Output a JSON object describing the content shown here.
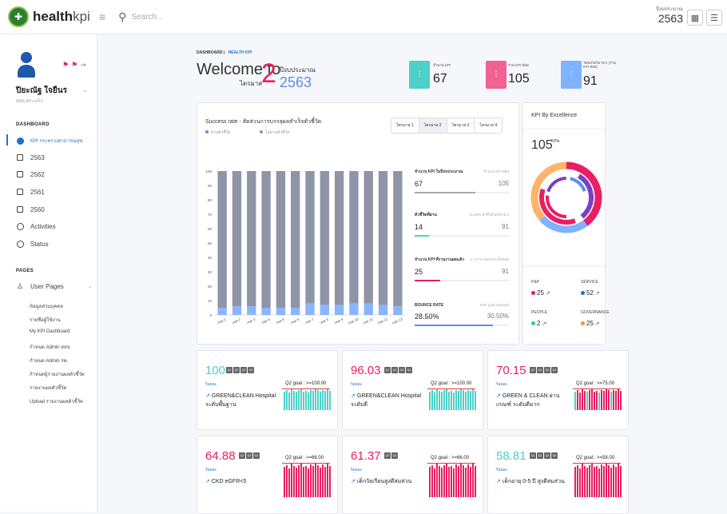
{
  "app": {
    "logo_main": "health",
    "logo_sub": "kpi"
  },
  "search": {
    "placeholder": "Search..."
  },
  "topbar": {
    "year_label": "ปีงบประมาณ",
    "year": "2563"
  },
  "user": {
    "name": "ปิยะณัฐ ใจยืนร",
    "org": "สสจ.สระแก้ว"
  },
  "nav": {
    "dashboard_label": "DASHBOARD",
    "kpi_item": "KPI กระทรวงสาธารณสุข",
    "years": [
      "2563",
      "2562",
      "2561",
      "2560"
    ],
    "activities": "Activities",
    "status": "Status",
    "pages_label": "PAGES",
    "user_pages": "User Pages",
    "sub_pages": [
      "ข้อมูลส่วนบุคคล",
      "รายชื่อผู้ใช้งาน",
      "My KPI Dashboard",
      "กำหนด Admin สสจ.",
      "กำหนด Admin รพ.",
      "กำหนดผู้รายงานผลตัวชี้วัด",
      "รายงานผลตัวชี้วัด",
      "Upload รายงานผลตัวชี้วัด"
    ]
  },
  "header": {
    "crumb1": "DASHBOARD",
    "crumb2": "HEALTH KPI",
    "welcome": "Welcome to",
    "quarter_label": "ไตรมาส",
    "quarter": "2",
    "budget_label": "ปีงบประมาณ",
    "budget_year": "2563"
  },
  "stats": [
    {
      "label": "จำนวน KPI",
      "value": "67",
      "color": "#4dd0c8"
    },
    {
      "label": "รวม KPI ย่อย",
      "value": "105",
      "color": "#f06292"
    },
    {
      "label": "วัดผลไตรมาส 2 (รวม KPI ย่อย)",
      "value": "91",
      "color": "#7fb2ff"
    }
  ],
  "success": {
    "title": "Success rate - สัดส่วนการบรรลุผลสำเร็จตัวชี้วัด",
    "legend": [
      {
        "label": "ผ่านตัวชี้วัด",
        "color": "#5b8def"
      },
      {
        "label": "ไม่ผ่านตัวชี้วัด",
        "color": "#8e95a6"
      }
    ],
    "tabs": [
      "ไตรมาส 1",
      "ไตรมาส 2",
      "ไตรมาส 3",
      "ไตรมาส 4"
    ],
    "active_tab": 1
  },
  "chart_data": {
    "type": "bar",
    "categories": [
      "เขต 1",
      "เขต 2",
      "เขต 3",
      "เขต 4",
      "เขต 5",
      "เขต 6",
      "เขต 7",
      "เขต 8",
      "เขต 9",
      "เขต 10",
      "เขต 11",
      "เขต 12",
      "เขต 13"
    ],
    "series": [
      {
        "name": "ผ่านตัวชี้วัด",
        "values": [
          5,
          6,
          6,
          5,
          5,
          5,
          8,
          7,
          7,
          8,
          8,
          7,
          6
        ],
        "color": "#8ab4ff"
      },
      {
        "name": "ไม่ผ่านตัวชี้วัด",
        "values": [
          95,
          94,
          94,
          95,
          95,
          95,
          92,
          93,
          93,
          92,
          92,
          93,
          94
        ],
        "color": "#8e95a6"
      }
    ],
    "ylim": [
      0,
      100
    ],
    "yticks": [
      0,
      10,
      20,
      30,
      40,
      50,
      60,
      70,
      80,
      90,
      100
    ],
    "stacked": true,
    "grid": false
  },
  "side_stats": [
    {
      "label": "จำนวน KPI ในปีงบประมาณ",
      "right": "จำนวน KPI ย่อย",
      "v1": "67",
      "v2": "105",
      "pct": 64,
      "color": "#aaa"
    },
    {
      "label": "ตัวชี้วัดที่ผ่าน",
      "right": "15.38% ตัวชี้วัดไตรมาส 2",
      "v1": "14",
      "v2": "91",
      "pct": 15,
      "color": "#4dd0c8"
    },
    {
      "label": "จำนวน KPI ที่รายงานผลแล้ว",
      "right": "27.47% ของ KPI ทั้งหมด",
      "v1": "25",
      "v2": "91",
      "pct": 27,
      "color": "#e91e63"
    },
    {
      "label": "BOUNCE RATE",
      "right": "83% goal reached",
      "v1": "28.50%",
      "v2": "30.50%",
      "pct": 83,
      "color": "#5b8def"
    }
  ],
  "excellence": {
    "title": "KPI By Excellence",
    "count": "105",
    "count_unit": "KPIs",
    "categories": [
      {
        "name": "P&P",
        "value": "25",
        "color": "#e91e63"
      },
      {
        "name": "SERVICE",
        "value": "52",
        "color": "#1e6fcf"
      },
      {
        "name": "PEOPLE",
        "value": "2",
        "color": "#26c6c0"
      },
      {
        "name": "GOVERNANCE",
        "value": "25",
        "color": "#ff8a3d"
      }
    ]
  },
  "kpi_cards": [
    {
      "value": "100",
      "color": "#4dd0c8",
      "badges": [
        "Q1",
        "Q2",
        "Q3",
        "Q4"
      ],
      "label": "ร้อยละ",
      "name": "GREEN&CLEAN Hospital ระดับพื้นฐาน",
      "goal": "Q2 goal : >=100.00",
      "bar_color": "#4dd0c8"
    },
    {
      "value": "96.03",
      "color": "#e91e63",
      "badges": [
        "Q1",
        "Q2",
        "Q3",
        "Q4"
      ],
      "label": "ร้อยละ",
      "name": "GREEN&CLEAN Hospital ระดับดี",
      "goal": "Q2 goal : >=100.00",
      "bar_color": "#4dd0c8"
    },
    {
      "value": "70.15",
      "color": "#e91e63",
      "badges": [
        "Q1",
        "Q2",
        "Q3",
        "Q4"
      ],
      "label": "ร้อยละ",
      "name": "GREEN & CLEAN ผ่านเกณฑ์ ระดับดีมาก",
      "goal": "Q2 goal : >=75.00",
      "bar_color": "#e91e63"
    },
    {
      "value": "64.88",
      "color": "#e91e63",
      "badges": [
        "Q2",
        "Q3",
        "Q4"
      ],
      "label": "ร้อยละ",
      "name": "CKD eGFR<5",
      "goal": "Q2 goal : >=66.00",
      "bar_color": "#e91e63"
    },
    {
      "value": "61.37",
      "color": "#e91e63",
      "badges": [
        "Q2",
        "Q4"
      ],
      "label": "ร้อยละ",
      "name": "เด็กวัยเรียนสูงดีสมส่วน",
      "goal": "Q2 goal : >=66.00",
      "bar_color": "#e91e63"
    },
    {
      "value": "58.81",
      "color": "#4dd0c8",
      "badges": [
        "Q1",
        "Q2",
        "Q3",
        "Q4"
      ],
      "label": "ร้อยละ",
      "name": "เด็กอายุ 0-5 ปี สูงดีสมส่วน",
      "goal": "Q2 goal : >=58.00",
      "bar_color": "#e91e63"
    }
  ]
}
